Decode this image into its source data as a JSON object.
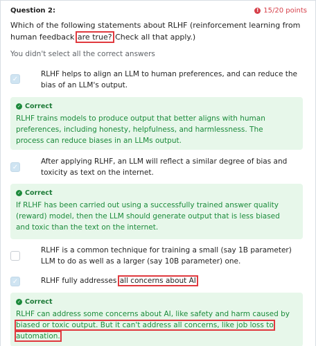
{
  "question": {
    "label": "Question 2:",
    "points": "15/20 points",
    "text_before": "Which of the following statements about RLHF (reinforcement learning from human feedback",
    "text_highlight": "are true?",
    "text_after": "Check all that apply.)"
  },
  "feedback": "You didn't select all the correct answers",
  "options": [
    {
      "text": "RLHF helps to align an LLM to human preferences, and can reduce the bias of an LLM's output.",
      "checked": true,
      "correct_label": "Correct",
      "correct_text": "RLHF trains models to produce output that better aligns with human preferences, including honesty, helpfulness, and harmlessness. The process can reduce biases in an LLMs output."
    },
    {
      "text": "After applying RLHF, an LLM will reflect a similar degree of bias and toxicity as text on the internet.",
      "checked": true,
      "correct_label": "Correct",
      "correct_text": "If RLHF has been carried out using a successfully trained answer quality (reward) model, then the LLM should generate output that is less biased and toxic than the text on the internet."
    },
    {
      "text": "RLHF is a common technique for training a small (say 1B parameter) LLM to do as well as a larger (say 10B parameter) one.",
      "checked": false
    },
    {
      "text_before": "RLHF fully addresses",
      "text_highlight": "all concerns about AI",
      "checked": true,
      "correct_label": "Correct",
      "correct_text_before": "RLHF can address some concerns about AI, like safety and harm caused by",
      "correct_text_highlight_1": "biased or toxic output. But it can't address all concerns, like job loss to",
      "correct_text_highlight_2": "automation."
    }
  ],
  "colors": {
    "correct_bg": "#e7f7ea",
    "correct_text": "#1a8a3a",
    "points": "#d6404a",
    "highlight_box": "#e0393e",
    "checkbox": "#cfe4f2"
  }
}
